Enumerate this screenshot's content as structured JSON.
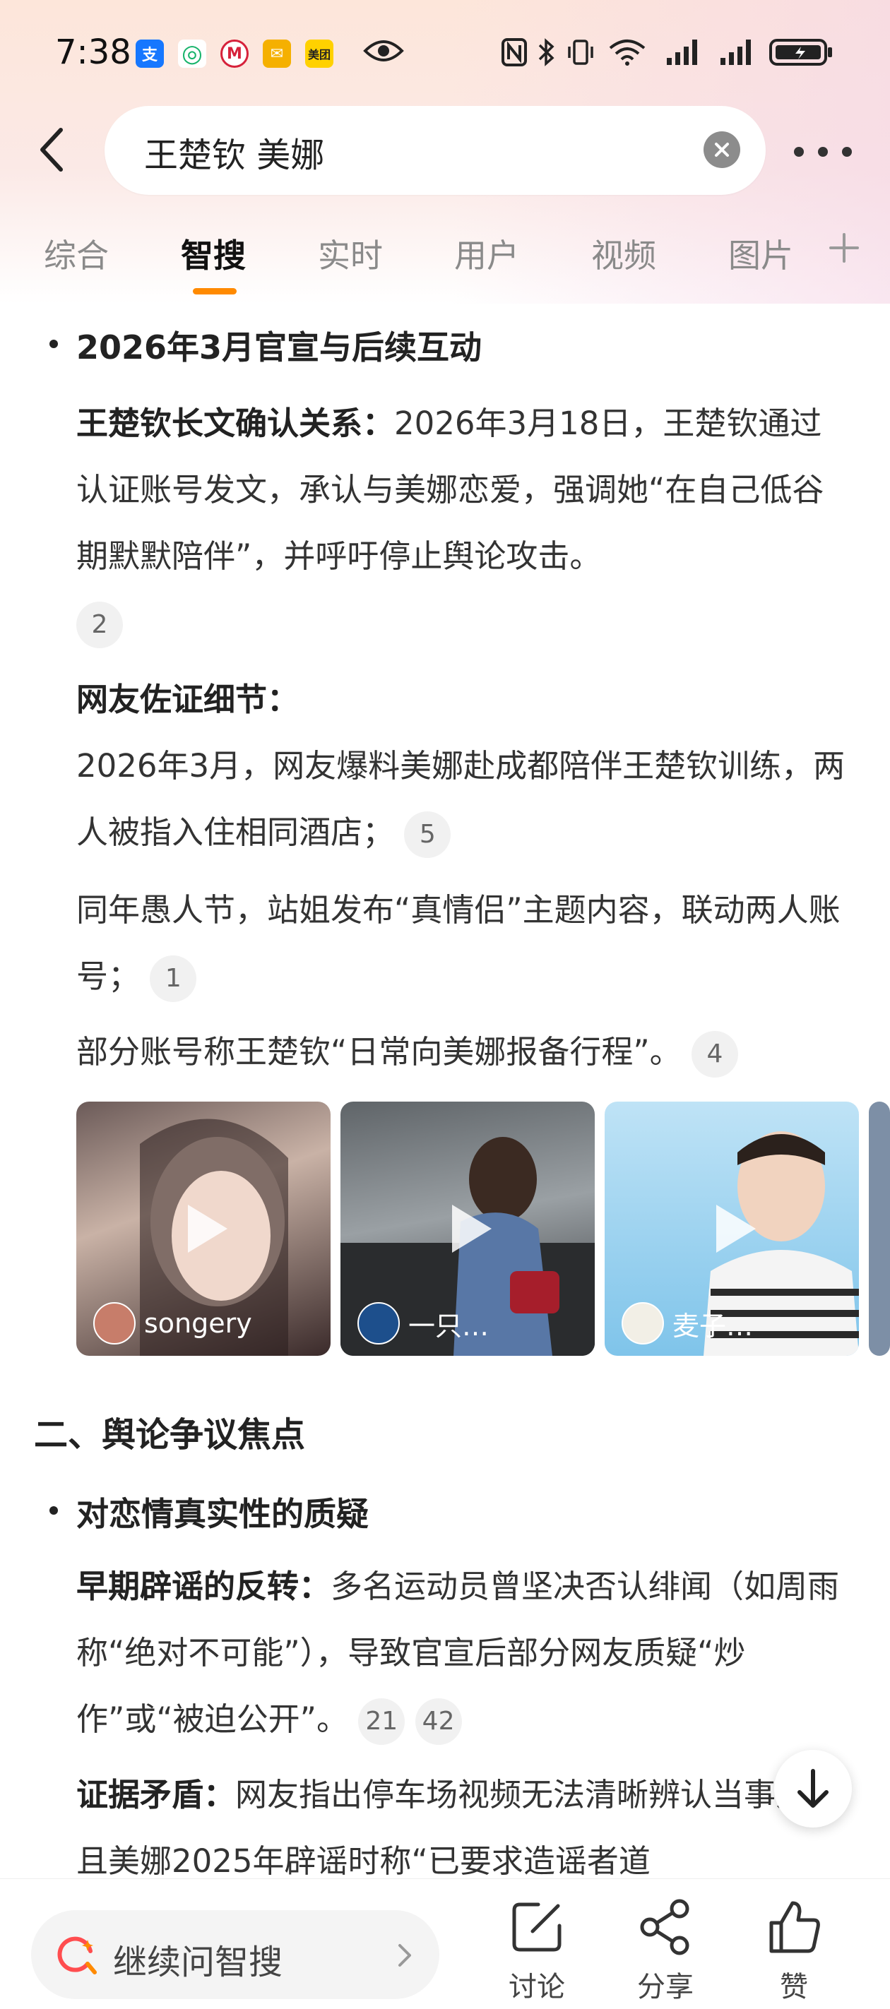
{
  "status_bar": {
    "time": "7:38",
    "app_icons": [
      {
        "name": "alipay-icon",
        "glyph": "支",
        "color": "#1677ff"
      },
      {
        "name": "cloud-app-icon",
        "glyph": "◎",
        "color": "#16b36a"
      },
      {
        "name": "metro-icon",
        "glyph": "M",
        "color": "#d6213a"
      },
      {
        "name": "mail-icon",
        "glyph": "✉",
        "color": "#f5b000"
      },
      {
        "name": "meituan-icon",
        "glyph": "美团",
        "color": "#ffd100"
      }
    ]
  },
  "search": {
    "query": "王楚钦 美娜"
  },
  "tabs": [
    {
      "label": "综合"
    },
    {
      "label": "智搜"
    },
    {
      "label": "实时"
    },
    {
      "label": "用户"
    },
    {
      "label": "视频"
    },
    {
      "label": "图片"
    }
  ],
  "content": {
    "bullet1_title": "2026年3月官宣与后续互动",
    "p1_bold": "王楚钦长文确认关系：",
    "p1_text": "2026年3月18日，王楚钦通过认证账号发文，承认与美娜恋爱，强调她“在自己低谷期默默陪伴”，并呼吁停止舆论攻击。",
    "p1_cite": "2",
    "p2_bold": "网友佐证细节：",
    "p3_text": "2026年3月，网友爆料美娜赴成都陪伴王楚钦训练，两人被指入住相同酒店；",
    "p3_cite": "5",
    "p4_text": "同年愚人节，站姐发布“真情侣”主题内容，联动两人账号；",
    "p4_cite": "1",
    "p5_text": "部分账号称王楚钦“日常向美娜报备行程”。",
    "p5_cite": "4",
    "videos": [
      {
        "author": "songery"
      },
      {
        "author": "一只…"
      },
      {
        "author": "麦子…"
      }
    ],
    "section2_title": "二、舆论争议焦点",
    "bullet2_title": "对恋情真实性的质疑",
    "p6_bold": "早期辟谣的反转：",
    "p6_text": "多名运动员曾坚决否认绯闻（如周雨称“绝对不可能”），导致官宣后部分网友质疑“炒作”或“被迫公开”。",
    "p6_cite_a": "21",
    "p6_cite_b": "42",
    "p7_bold": "证据矛盾：",
    "p7_text": "网友指出停车场视频无法清晰辨认当事人，且美娜2025年辟谣时称“已要求造谣者道"
  },
  "bottom_bar": {
    "ask_label": "继续问智搜",
    "discuss_label": "讨论",
    "share_label": "分享",
    "like_label": "赞"
  },
  "colors": {
    "accent": "#ff8a00",
    "ask_icon": "#ff4d4f"
  }
}
